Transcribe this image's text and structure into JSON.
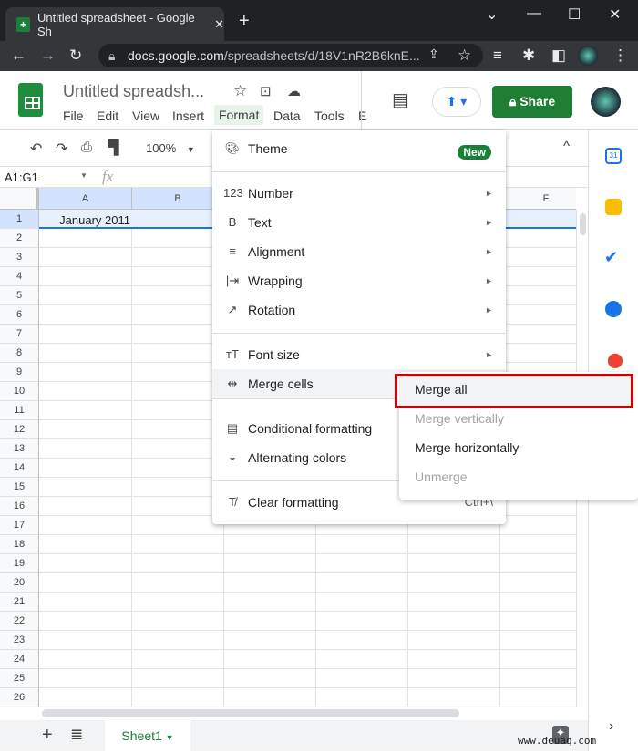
{
  "browser": {
    "tab_title": "Untitled spreadsheet - Google Sh",
    "url_host": "docs.google.com",
    "url_path": "/spreadsheets/d/18V1nR2B6knE..."
  },
  "doc": {
    "title": "Untitled spreadsh...",
    "menus": [
      "File",
      "Edit",
      "View",
      "Insert",
      "Format",
      "Data",
      "Tools",
      "E"
    ],
    "share_label": "Share"
  },
  "toolbar": {
    "zoom": "100%"
  },
  "formula": {
    "name_box": "A1:G1",
    "fx": "fx"
  },
  "grid": {
    "columns": [
      "A",
      "B",
      "C",
      "D",
      "E",
      "F"
    ],
    "rows": [
      1,
      2,
      3,
      4,
      5,
      6,
      7,
      8,
      9,
      10,
      11,
      12,
      13,
      14,
      15,
      16,
      17,
      18,
      19,
      20,
      21,
      22,
      23,
      24,
      25,
      26
    ],
    "a1": "January 2011"
  },
  "format_menu": {
    "theme": "Theme",
    "new_badge": "New",
    "items": [
      {
        "label": "Number",
        "icon": "123"
      },
      {
        "label": "Text",
        "icon": "B"
      },
      {
        "label": "Alignment",
        "icon": "≡"
      },
      {
        "label": "Wrapping",
        "icon": "|⇥"
      },
      {
        "label": "Rotation",
        "icon": "↗"
      },
      {
        "label": "Font size",
        "icon": "тT"
      },
      {
        "label": "Merge cells",
        "icon": "⇹"
      },
      {
        "label": "Conditional formatting",
        "icon": "▤"
      },
      {
        "label": "Alternating colors",
        "icon": "◒"
      },
      {
        "label": "Clear formatting",
        "icon": "T̸",
        "shortcut": "Ctrl+\\"
      }
    ]
  },
  "merge_submenu": {
    "items": [
      {
        "label": "Merge all",
        "enabled": true
      },
      {
        "label": "Merge vertically",
        "enabled": false
      },
      {
        "label": "Merge horizontally",
        "enabled": true
      },
      {
        "label": "Unmerge",
        "enabled": false
      }
    ]
  },
  "sheets": {
    "active": "Sheet1"
  },
  "watermark": "www.deuaq.com",
  "colors": {
    "accent": "#188038",
    "selection": "#1a73e8",
    "highlight_box": "#d50000"
  }
}
